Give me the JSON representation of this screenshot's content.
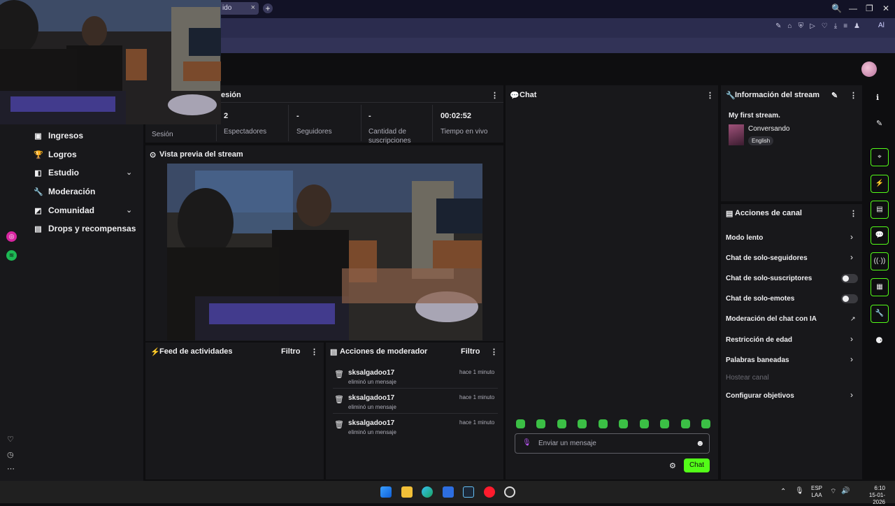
{
  "browser": {
    "tab_label": "ido",
    "tab_close": "×",
    "new_tab": "+",
    "ai_label": "Al",
    "extension_icons": [
      "✎",
      "⌂",
      "⛨",
      "▷",
      "♡",
      "⤓",
      "≡",
      "♟"
    ],
    "window_controls": [
      "🔍",
      "—",
      "❐",
      "✕"
    ]
  },
  "left_rail": {
    "social": [
      {
        "name": "instagram-icon",
        "color": "#d6249f"
      },
      {
        "name": "spotify-icon",
        "color": "#1db954"
      }
    ],
    "bottom_icons": [
      "♡",
      "◷",
      "⋯"
    ]
  },
  "side_nav": {
    "items": [
      {
        "label": "Ingresos",
        "icon": "▣"
      },
      {
        "label": "Logros",
        "icon": "🏆"
      },
      {
        "label": "Estudio",
        "icon": "◧",
        "chevron": "⌄"
      },
      {
        "label": "Moderación",
        "icon": "🔧"
      },
      {
        "label": "Comunidad",
        "icon": "◩",
        "chevron": "⌄"
      },
      {
        "label": "Drops y recompensas",
        "icon": "▤"
      }
    ]
  },
  "session": {
    "header": "esión",
    "menu": "⋮",
    "first_label": "Sesión",
    "stats": [
      {
        "value": "2",
        "label": "Espectadores"
      },
      {
        "value": "-",
        "label": "Seguidores"
      },
      {
        "value": "-",
        "label": "Cantidad de suscripciones"
      },
      {
        "value": "00:02:52",
        "label": "Tiempo en vivo"
      }
    ]
  },
  "preview": {
    "header": "Vista previa del stream",
    "icon": "⊙"
  },
  "activity_feed": {
    "header": "Feed de actividades",
    "filter": "Filtro",
    "menu": "⋮",
    "icon": "⚡"
  },
  "mod_actions": {
    "header": "Acciones de moderador",
    "filter": "Filtro",
    "menu": "⋮",
    "rows": [
      {
        "user": "sksalgadoo17",
        "action": "eliminó un mensaje",
        "time": "hace 1 minuto"
      },
      {
        "user": "sksalgadoo17",
        "action": "eliminó un mensaje",
        "time": "hace 1 minuto"
      },
      {
        "user": "sksalgadoo17",
        "action": "eliminó un mensaje",
        "time": "hace 1 minuto"
      }
    ]
  },
  "chat": {
    "header": "Chat",
    "menu": "⋮",
    "placeholder": "Enviar un mensaje",
    "send_label": "Chat",
    "settings_icon": "⚙",
    "emote_icon": "☻",
    "emote_count": 10,
    "accent": "#53fc18"
  },
  "stream_info": {
    "header": "Información del stream",
    "edit_icon": "✎",
    "menu": "⋮",
    "title": "My first stream.",
    "category": "Conversando",
    "language": "English"
  },
  "channel_actions": {
    "header": "Acciones de canal",
    "menu": "⋮",
    "items": [
      {
        "label": "Modo lento",
        "control": "chevron"
      },
      {
        "label": "Chat de solo-seguidores",
        "control": "chevron"
      },
      {
        "label": "Chat de solo-suscriptores",
        "control": "toggle"
      },
      {
        "label": "Chat de solo-emotes",
        "control": "toggle"
      },
      {
        "label": "Moderación del chat con IA",
        "control": "external"
      },
      {
        "label": "Restricción de edad",
        "control": "chevron"
      },
      {
        "label": "Palabras baneadas",
        "control": "chevron"
      },
      {
        "label": "Hostear canal",
        "control": "disabled"
      },
      {
        "label": "Configurar objetivos",
        "control": "chevron"
      }
    ]
  },
  "right_rail": {
    "top_icons": [
      "ℹ",
      "✎"
    ],
    "quick_actions": [
      "⌖",
      "⚡",
      "▤",
      "💬",
      "((·))",
      "▦",
      "🔧"
    ],
    "bottom_icon": "⚈"
  },
  "taskbar": {
    "lang_top": "ESP",
    "lang_bottom": "LAA",
    "time": "6:10",
    "date": "15-01-2026",
    "icons": [
      "windows-icon",
      "files-icon",
      "edge-icon",
      "store-icon",
      "steam-icon",
      "opera-icon",
      "obs-icon"
    ]
  }
}
